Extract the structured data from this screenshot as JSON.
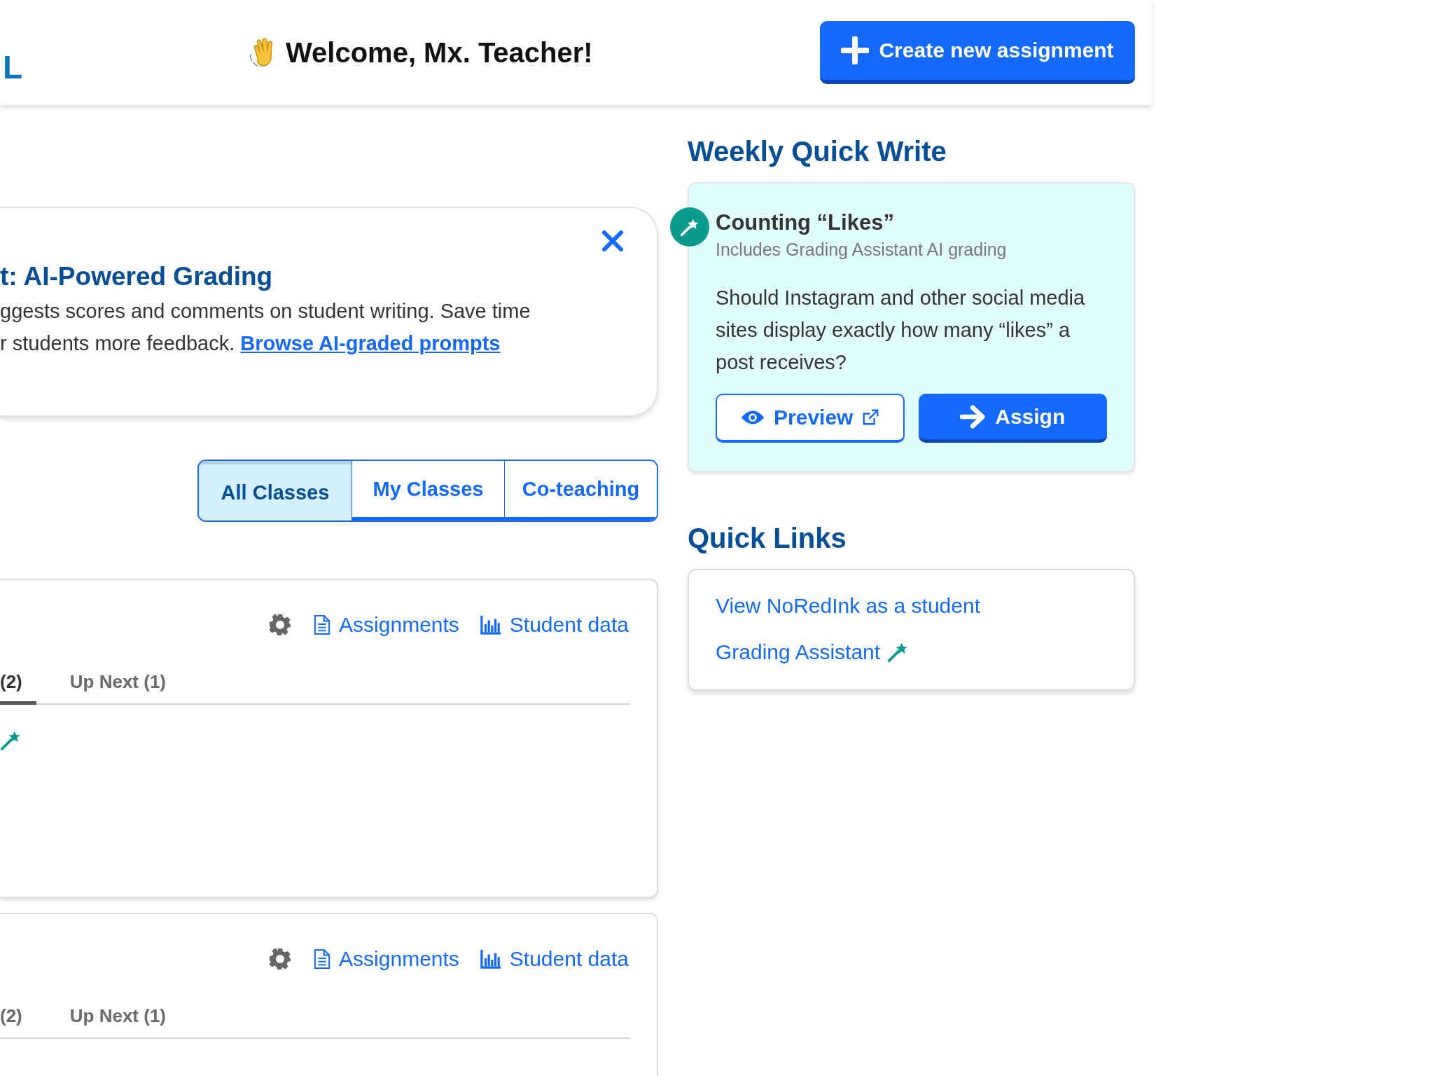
{
  "header": {
    "logo": "L",
    "greeting": "Welcome, Mx. Teacher!",
    "create_button": {
      "label": "Create new assignment"
    }
  },
  "banner": {
    "title": "t: AI-Powered Grading",
    "lines": [
      "ggests scores and comments on student writing. Save time",
      "r students more feedback. "
    ],
    "link": "Browse AI-graded prompts"
  },
  "class_filter": [
    {
      "label": "All Classes",
      "selected": true
    },
    {
      "label": "My Classes",
      "selected": false
    },
    {
      "label": "Co-teaching",
      "selected": false
    }
  ],
  "classes": [
    {
      "actions": [
        {
          "kind": "settings"
        },
        {
          "kind": "assignments",
          "label": "Assignments"
        },
        {
          "kind": "data",
          "label": "Student data"
        }
      ],
      "tabs": [
        {
          "label": "(2)",
          "selected": true
        },
        {
          "label": "Up Next (1)",
          "selected": false
        }
      ],
      "ai_graded": true
    },
    {
      "actions": [
        {
          "kind": "settings"
        },
        {
          "kind": "assignments",
          "label": "Assignments"
        },
        {
          "kind": "data",
          "label": "Student data"
        }
      ],
      "tabs": [
        {
          "label": "(2)",
          "selected": false
        },
        {
          "label": "Up Next (1)",
          "selected": false
        }
      ]
    }
  ],
  "weekly_quick_write": {
    "heading": "Weekly Quick Write",
    "title": "Counting “Likes”",
    "subtitle": "Includes Grading Assistant AI grading",
    "prompt": "Should Instagram and other social media sites display exactly how many “likes” a post receives?",
    "buttons": [
      {
        "kind": "preview",
        "label": "Preview"
      },
      {
        "kind": "assign",
        "label": "Assign"
      }
    ]
  },
  "quick_links": {
    "heading": "Quick Links",
    "links": [
      {
        "label": "View NoRedInk as a student"
      },
      {
        "label": "Grading Assistant",
        "ai": true
      }
    ]
  }
}
